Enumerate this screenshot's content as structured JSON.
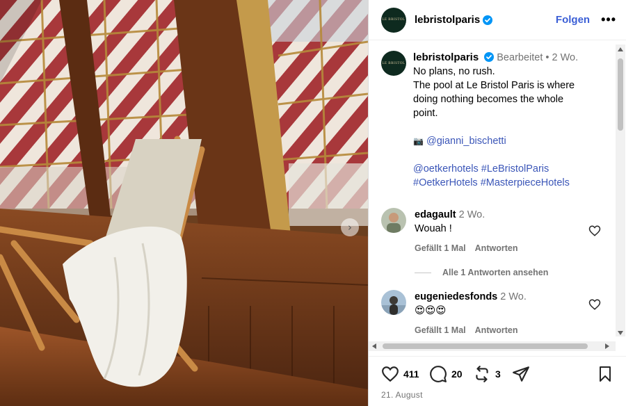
{
  "header": {
    "avatar_logo": "LE BRISTOL",
    "username": "lebristolparis",
    "follow_label": "Folgen",
    "more_label": "•••"
  },
  "caption": {
    "username": "lebristolparis",
    "edited": "Bearbeitet",
    "separator": "•",
    "age": "2 Wo.",
    "lines": [
      "No plans, no rush.",
      "The pool at Le Bristol Paris is where",
      "doing nothing becomes the whole",
      "point."
    ],
    "photo_credit_icon": "📷",
    "photo_credit": "@gianni_bischetti",
    "tags_line1": [
      "@oetkerhotels",
      "#LeBristolParis"
    ],
    "tags_line2": [
      "#OetkerHotels",
      "#MasterpieceHotels"
    ]
  },
  "comments": [
    {
      "username": "edagault",
      "age": "2 Wo.",
      "text": "Wouah !",
      "likes": "Gefällt 1 Mal",
      "reply_label": "Antworten",
      "view_replies": "Alle 1 Antworten ansehen"
    },
    {
      "username": "eugeniedesfonds",
      "age": "2 Wo.",
      "text": "😍😍😍",
      "likes": "Gefällt 1 Mal",
      "reply_label": "Antworten"
    }
  ],
  "actions": {
    "likes": "411",
    "comments": "20",
    "reposts": "3"
  },
  "date": "21. August",
  "carousel_next_icon": "›",
  "colors": {
    "link": "#3b56b8",
    "follow": "#3b5fd6",
    "verified": "#0095f6",
    "avatar_bg": "#0e2a1f"
  }
}
